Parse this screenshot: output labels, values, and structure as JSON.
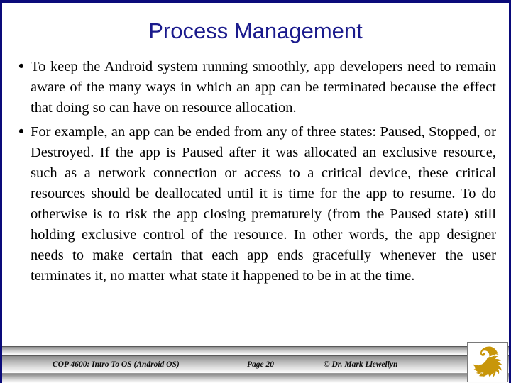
{
  "slide": {
    "title": "Process Management",
    "accent_color": "#1a1a8c",
    "border_color": "#0a0a7a",
    "bullet_glyph": "•",
    "bullets": [
      "To keep the Android system running smoothly, app developers need to remain aware of the many ways in which an app can be terminated because the effect that doing so can have on resource allocation.",
      "For example, an app can be ended from any of three states: Paused, Stopped, or Destroyed.  If the app is Paused after it was allocated an exclusive resource, such as a network connection or access to a critical device, these critical resources should be deallocated until it is time for the app to resume.  To do otherwise is to risk the app closing prematurely (from the Paused state) still holding exclusive control of the resource.  In other words, the app designer needs to make certain that each app ends gracefully whenever the user terminates it, no matter what state it happened to be in at the time."
    ]
  },
  "footer": {
    "course": "COP 4600: Intro To OS  (Android OS)",
    "page": "Page 20",
    "credit": "© Dr. Mark Llewellyn",
    "logo_name": "ucf-pegasus-logo",
    "logo_color": "#c8960a"
  }
}
